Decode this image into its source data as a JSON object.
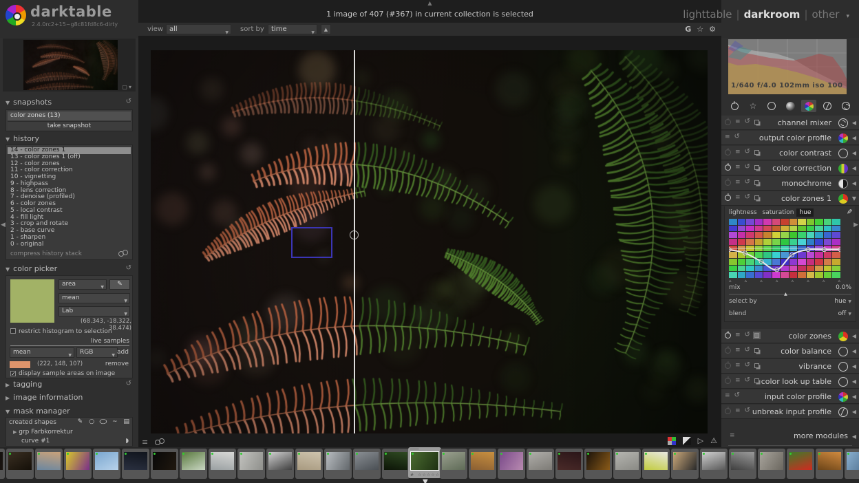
{
  "app": {
    "name": "darktable",
    "version": "2.4.0rc2+15~g8c81fd8c6-dirty"
  },
  "top": {
    "status": "1 image of 407 (#367) in current collection is selected",
    "views": {
      "lighttable": "lighttable",
      "darkroom": "darkroom",
      "other": "other"
    }
  },
  "toolbar": {
    "view_label": "view",
    "view_value": "all",
    "sort_label": "sort by",
    "sort_value": "time",
    "grouping_icon": "G",
    "star_icon": "☆",
    "gear_icon": "⚙"
  },
  "left": {
    "snapshots": {
      "title": "snapshots",
      "row": "color zones (13)",
      "button": "take snapshot"
    },
    "history": {
      "title": "history",
      "items": [
        "14 - color zones 1",
        "13 - color zones 1 (off)",
        "12 - color zones",
        "11 - color correction",
        "10 - vignetting",
        "9 - highpass",
        "8 - lens correction",
        "7 - denoise (profiled)",
        "6 - color zones",
        "5 - local contrast",
        "4 - fill light",
        "3 - crop and rotate",
        "2 - base curve",
        "1 - sharpen",
        "0 - original"
      ],
      "selected_index": 0,
      "compress": "compress history stack"
    },
    "picker": {
      "title": "color picker",
      "mode": "area",
      "stat": "mean",
      "space": "Lab",
      "reading": "(68.343, -18.322, 38.474)",
      "swatch_color": "#a2b266",
      "restrict_label": "restrict histogram to selection",
      "live_samples_label": "live samples",
      "sample_stat": "mean",
      "sample_space": "RGB",
      "add_label": "add",
      "sample_reading": "(222, 148, 107)",
      "sample_color": "rgb(222,148,107)",
      "remove_label": "remove",
      "display_label": "display sample areas on image",
      "display_check": "✓"
    },
    "tagging_title": "tagging",
    "info_title": "image information",
    "mask": {
      "title": "mask manager",
      "created": "created shapes",
      "group_item": "grp Farbkorrektur",
      "curve_item": "curve #1"
    }
  },
  "right": {
    "histogram_exif": "1/640 f/4.0 102mm iso 100",
    "groups": [
      "active-modules",
      "favorites",
      "basic-group",
      "tone-group",
      "color-group",
      "correction-group",
      "effects-group"
    ],
    "active_group": "color-group",
    "modules_top": [
      {
        "name": "channel mixer",
        "icon": "swirl",
        "left": [
          "power",
          "presets",
          "reset",
          "inst"
        ],
        "on": false,
        "expanded": false
      },
      {
        "name": "output color profile",
        "icon": "pie",
        "left": [
          "presets",
          "reset"
        ],
        "on": null,
        "expanded": false
      },
      {
        "name": "color contrast",
        "icon": "circle",
        "left": [
          "power",
          "presets",
          "reset",
          "inst"
        ],
        "on": false,
        "expanded": false
      },
      {
        "name": "color correction",
        "icon": "bands",
        "left": [
          "power",
          "presets",
          "reset",
          "inst"
        ],
        "on": true,
        "expanded": false
      },
      {
        "name": "monochrome",
        "icon": "half",
        "left": [
          "power",
          "presets",
          "reset",
          "inst"
        ],
        "on": false,
        "expanded": false
      },
      {
        "name": "color zones 1",
        "icon": "wheel",
        "left": [
          "power",
          "presets",
          "reset",
          "inst"
        ],
        "on": true,
        "expanded": true
      }
    ],
    "modules_bottom": [
      {
        "name": "color zones",
        "icon": "wheel",
        "left": [
          "power",
          "presets",
          "reset",
          "inst-hl"
        ],
        "on": true,
        "expanded": false
      },
      {
        "name": "color balance",
        "icon": "circle",
        "left": [
          "power",
          "presets",
          "reset",
          "inst"
        ],
        "on": false,
        "expanded": false
      },
      {
        "name": "vibrance",
        "icon": "circle",
        "left": [
          "power",
          "presets",
          "reset",
          "inst"
        ],
        "on": false,
        "expanded": false
      },
      {
        "name": "color look up table",
        "icon": "circle",
        "left": [
          "power",
          "presets",
          "reset",
          "inst"
        ],
        "on": false,
        "expanded": false
      },
      {
        "name": "input color profile",
        "icon": "pie",
        "left": [
          "presets",
          "reset"
        ],
        "on": null,
        "expanded": false
      },
      {
        "name": "unbreak input profile",
        "icon": "slash",
        "left": [
          "power",
          "presets",
          "reset"
        ],
        "on": false,
        "expanded": false
      }
    ],
    "zones": {
      "tabs": [
        "lightness",
        "saturation",
        "hue"
      ],
      "active_tab": "hue",
      "curve_points": [
        [
          0,
          0.52
        ],
        [
          0.145,
          0.58
        ],
        [
          0.29,
          0.72
        ],
        [
          0.43,
          0.86
        ],
        [
          0.565,
          0.61
        ],
        [
          0.71,
          0.52
        ],
        [
          0.855,
          0.52
        ],
        [
          1,
          0.52
        ]
      ],
      "baseline": 0.5,
      "marker_count": 8,
      "mix_label": "mix",
      "mix_value": "0.0%",
      "mix_pos": 0.45,
      "select_by_label": "select by",
      "select_by_value": "hue",
      "blend_label": "blend",
      "blend_value": "off"
    },
    "more_modules": "more modules"
  },
  "filmstrip": {
    "selected_index": 15,
    "thumbs": [
      {
        "c1": "#0b0b0b",
        "c2": "#1a1410"
      },
      {
        "c1": "#3a2f22",
        "c2": "#140f08"
      },
      {
        "c1": "#c9a27a",
        "c2": "#6b87a0"
      },
      {
        "c1": "#d8c92a",
        "c2": "#7a2f8a"
      },
      {
        "c1": "#7aa7d0",
        "c2": "#b8d2ea"
      },
      {
        "c1": "#10141c",
        "c2": "#2a3040"
      },
      {
        "c1": "#080808",
        "c2": "#20180f"
      },
      {
        "c1": "#5a7a3f",
        "c2": "#c9d6c2"
      },
      {
        "c1": "#d8d8d6",
        "c2": "#9aa0a2"
      },
      {
        "c1": "#c2c2be",
        "c2": "#8f908c"
      },
      {
        "c1": "#d0d0d0",
        "c2": "#404040"
      },
      {
        "c1": "#cfc4ae",
        "c2": "#a89a80"
      },
      {
        "c1": "#b8bcc0",
        "c2": "#63686c"
      },
      {
        "c1": "#8a8f94",
        "c2": "#4a4f54"
      },
      {
        "c1": "#2f4a22",
        "c2": "#0c1407"
      },
      {
        "c1": "#4a6b30",
        "c2": "#1e3012"
      },
      {
        "c1": "#9aa08f",
        "c2": "#5f6b57"
      },
      {
        "c1": "#c9903f",
        "c2": "#8a5f33"
      },
      {
        "c1": "#7a4a8a",
        "c2": "#b88ab0"
      },
      {
        "c1": "#b0aeaa",
        "c2": "#7d7b76"
      },
      {
        "c1": "#2a1518",
        "c2": "#4a2a28"
      },
      {
        "c1": "#1a120a",
        "c2": "#8a5a18"
      },
      {
        "c1": "#b5b5b0",
        "c2": "#8a8a85"
      },
      {
        "c1": "#e8e8e0",
        "c2": "#c2cc3f"
      },
      {
        "c1": "#caa87a",
        "c2": "#2a2a2a"
      },
      {
        "c1": "#cfcfcf",
        "c2": "#5a5a5a"
      },
      {
        "c1": "#9a9a9a",
        "c2": "#3f3f3f"
      },
      {
        "c1": "#a8a49c",
        "c2": "#6b675f"
      },
      {
        "c1": "#3f7a2a",
        "c2": "#d02a20"
      },
      {
        "c1": "#d08a3f",
        "c2": "#6b4418"
      },
      {
        "c1": "#8ab0d0",
        "c2": "#4a6b8a"
      }
    ],
    "stars": "☆☆☆☆☆"
  }
}
